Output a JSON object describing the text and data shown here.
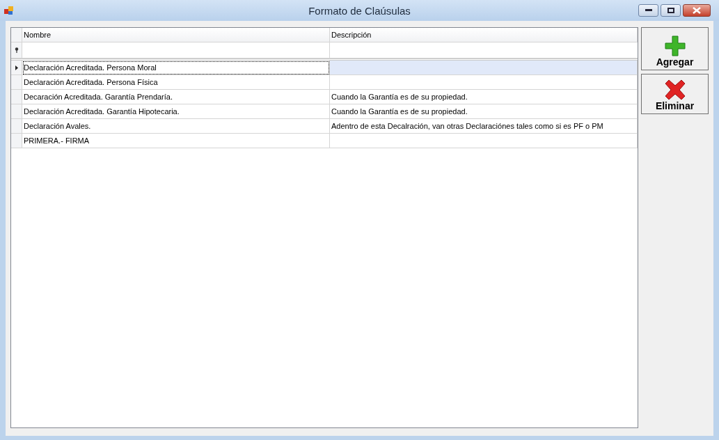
{
  "window": {
    "title": "Formato de Claúsulas"
  },
  "table": {
    "columns": [
      "Nombre",
      "Descripción"
    ],
    "rows": [
      {
        "nombre": "Declaración Acreditada. Persona Moral",
        "descripcion": "",
        "selected": true
      },
      {
        "nombre": "Declaración Acreditada. Persona Física",
        "descripcion": "",
        "selected": false
      },
      {
        "nombre": "Decaración Acreditada. Garantía Prendaría.",
        "descripcion": "Cuando la Garantía es de su propiedad.",
        "selected": false
      },
      {
        "nombre": "Declaración Acreditada. Garantía Hipotecaria.",
        "descripcion": "Cuando la Garantía es de su propiedad.",
        "selected": false
      },
      {
        "nombre": "Declaración Avales.",
        "descripcion": "Adentro de esta Decalración, van otras Declaraciónes tales como si es PF o PM",
        "selected": false
      },
      {
        "nombre": "PRIMERA.- FIRMA",
        "descripcion": "",
        "selected": false
      }
    ]
  },
  "buttons": [
    {
      "label": "Agregar",
      "kind": "add"
    },
    {
      "label": "Eliminar",
      "kind": "delete"
    }
  ]
}
